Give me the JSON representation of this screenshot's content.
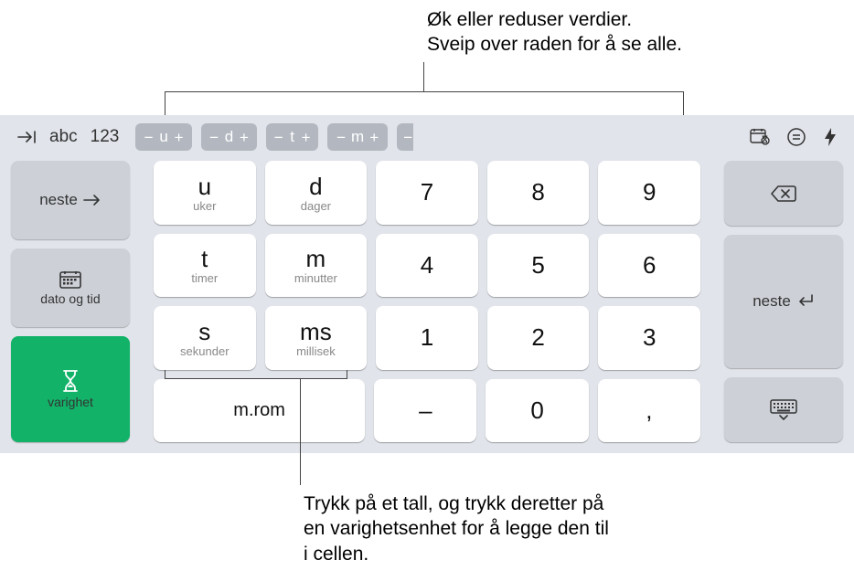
{
  "callouts": {
    "top": "Øk eller reduser verdier. Sveip over raden for å se alle.",
    "bottom": "Trykk på et tall, og trykk deretter på en varighetsenhet for å legge den til i cellen."
  },
  "top": {
    "abc": "abc",
    "n123": "123",
    "step": [
      "u",
      "d",
      "t",
      "m"
    ]
  },
  "left": {
    "next": "neste",
    "datetime": "dato og tid",
    "duration": "varighet"
  },
  "units": {
    "u": {
      "a": "u",
      "s": "uker"
    },
    "d": {
      "a": "d",
      "s": "dager"
    },
    "t": {
      "a": "t",
      "s": "timer"
    },
    "m": {
      "a": "m",
      "s": "minutter"
    },
    "s": {
      "a": "s",
      "s": "sekunder"
    },
    "ms": {
      "a": "ms",
      "s": "millisek"
    }
  },
  "num": {
    "7": "7",
    "8": "8",
    "9": "9",
    "4": "4",
    "5": "5",
    "6": "6",
    "1": "1",
    "2": "2",
    "3": "3",
    "0": "0",
    "dash": "–",
    "comma": ","
  },
  "space": "m.rom",
  "right": {
    "next": "neste"
  }
}
